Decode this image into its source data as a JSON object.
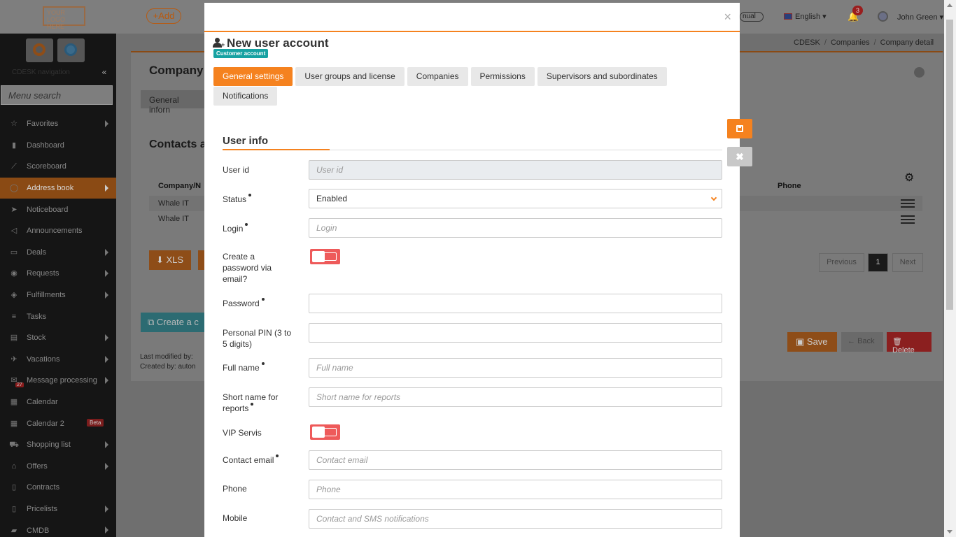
{
  "topbar": {
    "logo_text": "YOUR LOGO HERE",
    "add_label": "+Add",
    "manual_label": "nual",
    "language": "English",
    "notifications_count": "3",
    "user_name": "John Green"
  },
  "sidebar": {
    "nav_title": "CDESK navigation",
    "search_placeholder": "Menu search",
    "items": [
      {
        "label": "Favorites",
        "icon": "star-icon"
      },
      {
        "label": "Dashboard",
        "icon": "bar-chart-icon"
      },
      {
        "label": "Scoreboard",
        "icon": "line-chart-icon"
      },
      {
        "label": "Address book",
        "icon": "user-icon"
      },
      {
        "label": "Noticeboard",
        "icon": "paper-plane-icon"
      },
      {
        "label": "Announcements",
        "icon": "megaphone-icon"
      },
      {
        "label": "Deals",
        "icon": "wallet-icon"
      },
      {
        "label": "Requests",
        "icon": "check-circle-icon"
      },
      {
        "label": "Fulfillments",
        "icon": "box-icon"
      },
      {
        "label": "Tasks",
        "icon": "list-icon"
      },
      {
        "label": "Stock",
        "icon": "archive-icon"
      },
      {
        "label": "Vacations",
        "icon": "plane-icon"
      },
      {
        "label": "Message processing",
        "icon": "envelope-icon",
        "badge": "27"
      },
      {
        "label": "Calendar",
        "icon": "calendar-icon"
      },
      {
        "label": "Calendar 2",
        "icon": "calendar-icon",
        "tag": "Beta"
      },
      {
        "label": "Shopping list",
        "icon": "cart-icon"
      },
      {
        "label": "Offers",
        "icon": "gift-icon"
      },
      {
        "label": "Contracts",
        "icon": "document-icon"
      },
      {
        "label": "Pricelists",
        "icon": "document-icon"
      },
      {
        "label": "CMDB",
        "icon": "folder-icon"
      }
    ]
  },
  "breadcrumb": [
    "CDESK",
    "Companies",
    "Company detail"
  ],
  "background": {
    "title": "Company",
    "tab": "General inforn",
    "contacts_title": "Contacts a",
    "col_company": "Company/N",
    "col_phone": "Phone",
    "rows": [
      "Whale IT",
      "Whale IT"
    ],
    "xls_label": "XLS",
    "create_label": "Create a c",
    "last_modified": "Last modified by:",
    "created_by": "Created by: auton",
    "pager_previous": "Previous",
    "pager_page": "1",
    "pager_next": "Next",
    "save_label": "Save",
    "back_label": "Back",
    "delete_label": "Delete"
  },
  "modal": {
    "title": "New user account",
    "badge": "Customer account",
    "close_symbol": "×",
    "tabs": [
      "General settings",
      "User groups and license",
      "Companies",
      "Permissions",
      "Supervisors and subordinates",
      "Notifications"
    ],
    "section_title": "User info",
    "cancel_symbol": "✖",
    "fields": {
      "user_id": {
        "label": "User id",
        "placeholder": "User id"
      },
      "status": {
        "label": "Status",
        "value": "Enabled"
      },
      "login": {
        "label": "Login",
        "placeholder": "Login"
      },
      "create_password": {
        "label": "Create a password via email?"
      },
      "password": {
        "label": "Password"
      },
      "pin": {
        "label": "Personal PIN (3 to 5 digits)"
      },
      "full_name": {
        "label": "Full name",
        "placeholder": "Full name"
      },
      "short_name": {
        "label": "Short name for reports",
        "placeholder": "Short name for reports"
      },
      "vip": {
        "label": "VIP Servis"
      },
      "contact_email": {
        "label": "Contact email",
        "placeholder": "Contact email"
      },
      "phone": {
        "label": "Phone",
        "placeholder": "Phone"
      },
      "mobile": {
        "label": "Mobile",
        "placeholder": "Contact and SMS notifications"
      }
    }
  },
  "colors": {
    "accent": "#f5821f",
    "toggle_off": "#ee5a5a",
    "badge": "#17a2a2"
  }
}
